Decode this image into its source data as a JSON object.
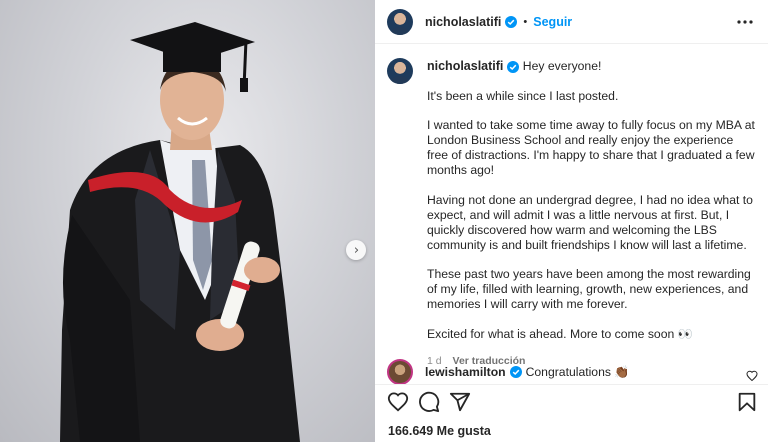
{
  "post": {
    "author": "nicholaslatifi",
    "follow_label": "Seguir",
    "dot": "•",
    "caption": {
      "greeting": "Hey everyone!",
      "paragraphs": [
        "It's been a while since I last posted.",
        "I wanted to take some time away to fully focus on my MBA at London Business School and really enjoy the experience free of distractions. I'm happy to share that I graduated a few months ago!",
        "Having not done an undergrad degree, I had no idea what to expect, and will admit I was a little nervous at first. But, I quickly discovered how warm and welcoming the LBS community is and built friendships I know will last a lifetime.",
        "These past two years have been among the most rewarding of my life, filled with learning, growth, new experiences, and memories I will carry with me forever.",
        "Excited for what is ahead. More to come soon 👀"
      ]
    },
    "time_ago": "1 d",
    "translate_label": "Ver traducción",
    "comment": {
      "author": "lewishamilton",
      "text": "Congratulations 👏🏾"
    },
    "likes": "166.649 Me gusta"
  },
  "colors": {
    "accent": "#0095f6",
    "verified": "#0095f6",
    "text": "#262626",
    "muted": "#8e8e8e"
  },
  "icons": {
    "more": "more-options-icon",
    "like": "heart-icon",
    "comment": "comment-icon",
    "share": "share-icon",
    "save": "bookmark-icon",
    "next": "chevron-right-icon"
  }
}
